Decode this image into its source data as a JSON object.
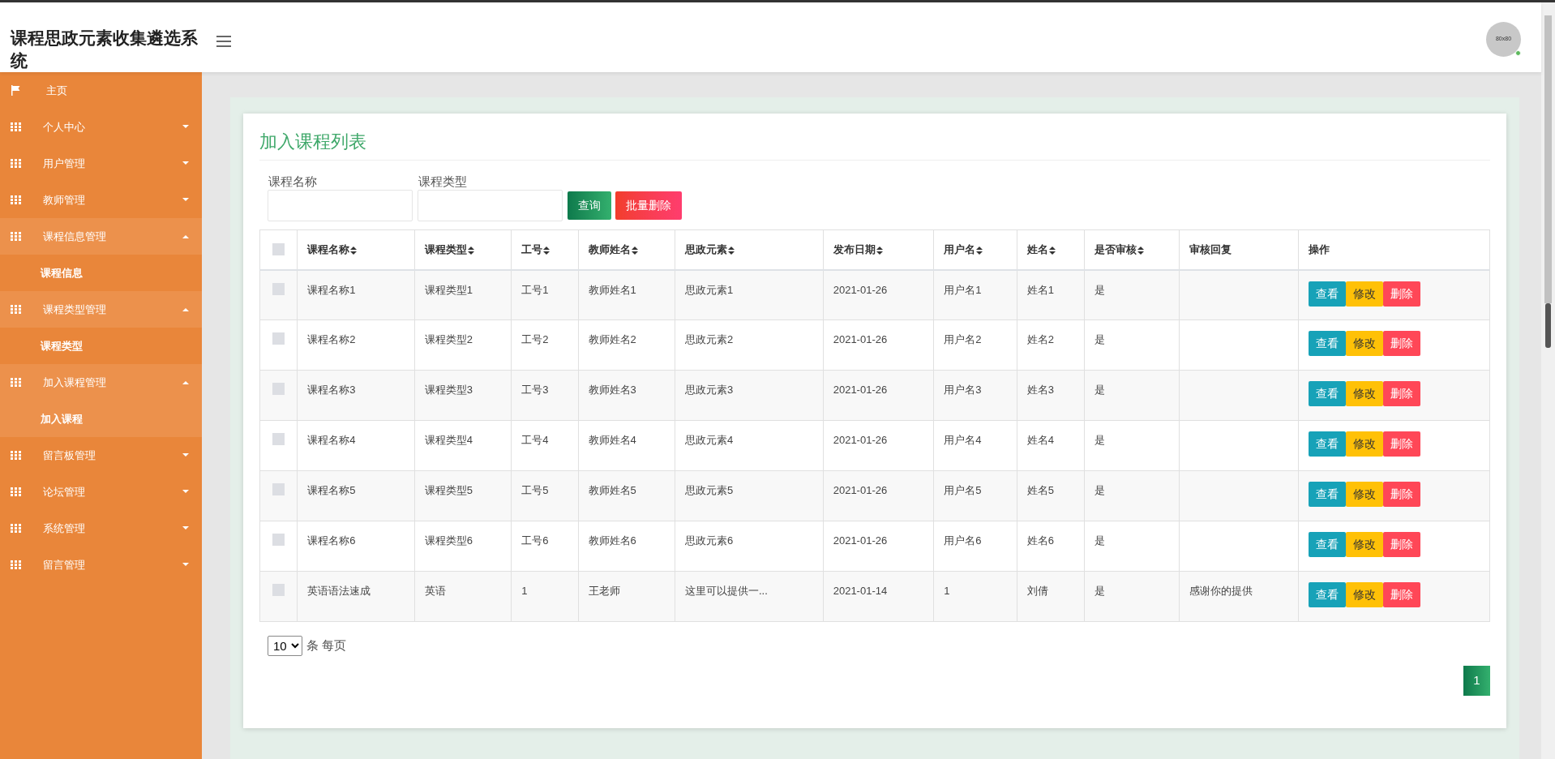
{
  "header": {
    "title": "课程思政元素收集遴选系统",
    "avatar_text": "80x80"
  },
  "sidebar": {
    "items": [
      {
        "kind": "link",
        "label": "主页",
        "selected": false
      },
      {
        "kind": "menu",
        "label": "个人中心",
        "expanded": false
      },
      {
        "kind": "menu",
        "label": "用户管理",
        "expanded": false
      },
      {
        "kind": "menu",
        "label": "教师管理",
        "expanded": false
      },
      {
        "kind": "menu",
        "label": "课程信息管理",
        "expanded": true,
        "children": [
          {
            "label": "课程信息",
            "selected": false
          }
        ]
      },
      {
        "kind": "menu",
        "label": "课程类型管理",
        "expanded": true,
        "children": [
          {
            "label": "课程类型",
            "selected": false
          }
        ]
      },
      {
        "kind": "menu",
        "label": "加入课程管理",
        "expanded": true,
        "children": [
          {
            "label": "加入课程",
            "selected": true
          }
        ]
      },
      {
        "kind": "menu",
        "label": "留言板管理",
        "expanded": false
      },
      {
        "kind": "menu",
        "label": "论坛管理",
        "expanded": false
      },
      {
        "kind": "menu",
        "label": "系统管理",
        "expanded": false
      },
      {
        "kind": "menu",
        "label": "留言管理",
        "expanded": false
      }
    ]
  },
  "card": {
    "title": "加入课程列表",
    "filters": [
      {
        "label": "课程名称"
      },
      {
        "label": "课程类型"
      }
    ],
    "buttons": [
      {
        "kind": "search",
        "label": "查询"
      },
      {
        "kind": "delete",
        "label": "批量删除"
      }
    ],
    "table": {
      "select_all_checked": false,
      "columns": [
        {
          "label": "课程名称",
          "sortable": true
        },
        {
          "label": "课程类型",
          "sortable": true
        },
        {
          "label": "工号",
          "sortable": true
        },
        {
          "label": "教师姓名",
          "sortable": true
        },
        {
          "label": "思政元素",
          "sortable": true
        },
        {
          "label": "发布日期",
          "sortable": true
        },
        {
          "label": "用户名",
          "sortable": true
        },
        {
          "label": "姓名",
          "sortable": true
        },
        {
          "label": "是否审核",
          "sortable": true
        },
        {
          "label": "审核回复",
          "sortable": false
        },
        {
          "label": "操作",
          "sortable": false
        }
      ],
      "rows": [
        {
          "checked": false,
          "cells": [
            "课程名称1",
            "课程类型1",
            "工号1",
            "教师姓名1",
            "思政元素1",
            "2021-01-26",
            "用户名1",
            "姓名1",
            "是",
            ""
          ],
          "actions": [
            "查看",
            "修改",
            "删除"
          ]
        },
        {
          "checked": false,
          "cells": [
            "课程名称2",
            "课程类型2",
            "工号2",
            "教师姓名2",
            "思政元素2",
            "2021-01-26",
            "用户名2",
            "姓名2",
            "是",
            ""
          ],
          "actions": [
            "查看",
            "修改",
            "删除"
          ]
        },
        {
          "checked": false,
          "cells": [
            "课程名称3",
            "课程类型3",
            "工号3",
            "教师姓名3",
            "思政元素3",
            "2021-01-26",
            "用户名3",
            "姓名3",
            "是",
            ""
          ],
          "actions": [
            "查看",
            "修改",
            "删除"
          ]
        },
        {
          "checked": false,
          "cells": [
            "课程名称4",
            "课程类型4",
            "工号4",
            "教师姓名4",
            "思政元素4",
            "2021-01-26",
            "用户名4",
            "姓名4",
            "是",
            ""
          ],
          "actions": [
            "查看",
            "修改",
            "删除"
          ]
        },
        {
          "checked": false,
          "cells": [
            "课程名称5",
            "课程类型5",
            "工号5",
            "教师姓名5",
            "思政元素5",
            "2021-01-26",
            "用户名5",
            "姓名5",
            "是",
            ""
          ],
          "actions": [
            "查看",
            "修改",
            "删除"
          ]
        },
        {
          "checked": false,
          "cells": [
            "课程名称6",
            "课程类型6",
            "工号6",
            "教师姓名6",
            "思政元素6",
            "2021-01-26",
            "用户名6",
            "姓名6",
            "是",
            ""
          ],
          "actions": [
            "查看",
            "修改",
            "删除"
          ]
        },
        {
          "checked": false,
          "cells": [
            "英语语法速成",
            "英语",
            "1",
            "王老师",
            "这里可以提供一...",
            "2021-01-14",
            "1",
            "刘倩",
            "是",
            "感谢你的提供"
          ],
          "actions": [
            "查看",
            "修改",
            "删除"
          ]
        }
      ]
    },
    "pagination": {
      "page_size": "10",
      "page_size_label": "条 每页",
      "pages": [
        {
          "label": "1",
          "selected": true
        }
      ]
    }
  }
}
